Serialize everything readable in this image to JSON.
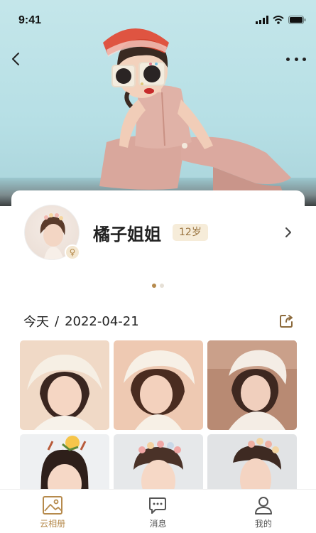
{
  "status_bar": {
    "time": "9:41"
  },
  "profile": {
    "name": "橘子姐姐",
    "age": "12岁",
    "gender_symbol": "♀"
  },
  "carousel": {
    "count": 2,
    "active_index": 0
  },
  "section": {
    "day": "今天",
    "separator": "/",
    "date": "2022-04-21"
  },
  "photos": [
    {
      "background": "#f0d9c6",
      "accent": "#f7f2ea"
    },
    {
      "background": "#eec9b2",
      "accent": "#f7f0e6"
    },
    {
      "background": "#b88a73",
      "accent": "#f4ede5"
    },
    {
      "background": "#eef0f2",
      "accent": "#f6c54a"
    },
    {
      "background": "#e6e8ea",
      "accent": "#f0a7a5"
    },
    {
      "background": "#e1e3e5",
      "accent": "#efb0a2"
    }
  ],
  "tabbar": {
    "items": [
      {
        "label": "云相册",
        "icon": "photo-album-icon",
        "active": true
      },
      {
        "label": "消息",
        "icon": "message-icon",
        "active": false
      },
      {
        "label": "我的",
        "icon": "profile-icon",
        "active": false
      }
    ]
  },
  "colors": {
    "accent": "#b68a4c",
    "age_badge_bg": "#f6ecd9",
    "age_badge_text": "#9a7440"
  }
}
